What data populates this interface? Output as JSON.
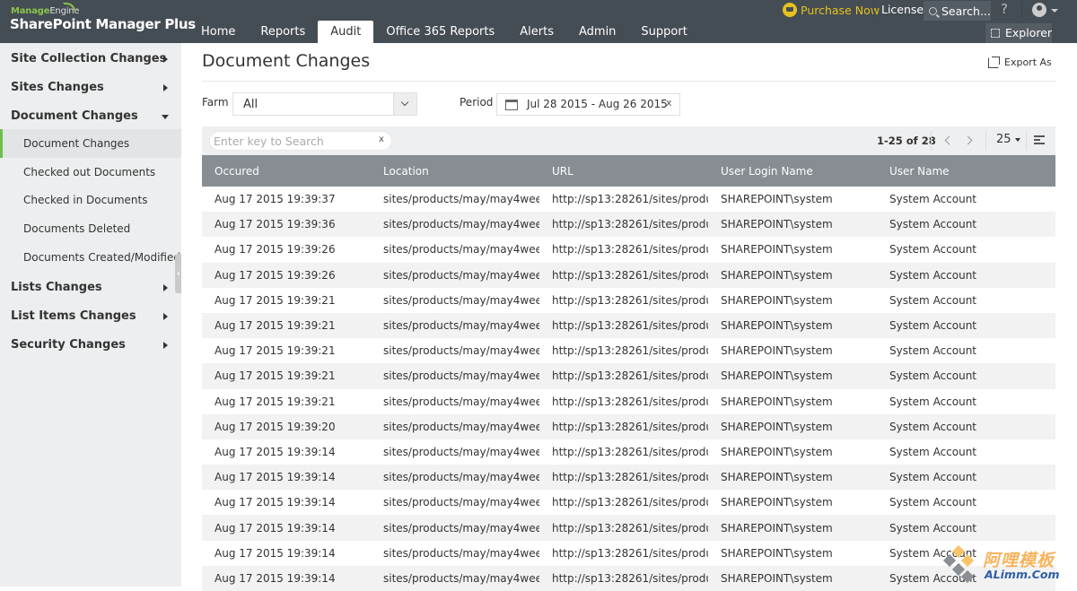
{
  "app": {
    "brand_prefix": "Manage",
    "brand_suffix": "Engine",
    "product_name": "SharePoint Manager Plus"
  },
  "nav": {
    "tabs": [
      {
        "label": "Home",
        "active": false
      },
      {
        "label": "Reports",
        "active": false
      },
      {
        "label": "Audit",
        "active": true
      },
      {
        "label": "Office 365 Reports",
        "active": false
      },
      {
        "label": "Alerts",
        "active": false
      },
      {
        "label": "Admin",
        "active": false
      },
      {
        "label": "Support",
        "active": false
      }
    ]
  },
  "header_actions": {
    "purchase_label": "Purchase Now",
    "license_label": "License",
    "search_label": "Search...",
    "help_label": "?",
    "explorer_label": "Explorer"
  },
  "sidebar": {
    "groups": [
      {
        "label": "Site Collection Changes",
        "expanded": false
      },
      {
        "label": "Sites Changes",
        "expanded": false
      },
      {
        "label": "Document Changes",
        "expanded": true,
        "items": [
          {
            "label": "Document Changes",
            "active": true
          },
          {
            "label": "Checked out Documents",
            "active": false
          },
          {
            "label": "Checked in Documents",
            "active": false
          },
          {
            "label": "Documents Deleted",
            "active": false
          },
          {
            "label": "Documents Created/Modified",
            "active": false
          }
        ]
      },
      {
        "label": "Lists Changes",
        "expanded": false
      },
      {
        "label": "List Items Changes",
        "expanded": false
      },
      {
        "label": "Security Changes",
        "expanded": false
      }
    ]
  },
  "main": {
    "title": "Document Changes",
    "export_label": "Export As",
    "farm_label": "Farm :",
    "farm_value": "All",
    "period_label": "Period :",
    "period_value": "Jul 28 2015 - Aug 26 2015",
    "period_clear": "x",
    "search_placeholder": "Enter key to Search",
    "search_value": "",
    "search_clear": "x",
    "pagination": "1-25 of 28",
    "per_page": "25"
  },
  "table": {
    "columns": [
      "Occured",
      "Location",
      "URL",
      "User Login Name",
      "User Name"
    ],
    "rows": [
      [
        "Aug 17 2015 19:39:37",
        "sites/products/may/may4wee...",
        "http://sp13:28261/sites/produ...",
        "SHAREPOINT\\system",
        "System Account"
      ],
      [
        "Aug 17 2015 19:39:36",
        "sites/products/may/may4wee...",
        "http://sp13:28261/sites/produ...",
        "SHAREPOINT\\system",
        "System Account"
      ],
      [
        "Aug 17 2015 19:39:26",
        "sites/products/may/may4wee...",
        "http://sp13:28261/sites/produ...",
        "SHAREPOINT\\system",
        "System Account"
      ],
      [
        "Aug 17 2015 19:39:26",
        "sites/products/may/may4wee...",
        "http://sp13:28261/sites/produ...",
        "SHAREPOINT\\system",
        "System Account"
      ],
      [
        "Aug 17 2015 19:39:21",
        "sites/products/may/may4wee...",
        "http://sp13:28261/sites/produ...",
        "SHAREPOINT\\system",
        "System Account"
      ],
      [
        "Aug 17 2015 19:39:21",
        "sites/products/may/may4wee...",
        "http://sp13:28261/sites/produ...",
        "SHAREPOINT\\system",
        "System Account"
      ],
      [
        "Aug 17 2015 19:39:21",
        "sites/products/may/may4wee...",
        "http://sp13:28261/sites/produ...",
        "SHAREPOINT\\system",
        "System Account"
      ],
      [
        "Aug 17 2015 19:39:21",
        "sites/products/may/may4wee...",
        "http://sp13:28261/sites/produ...",
        "SHAREPOINT\\system",
        "System Account"
      ],
      [
        "Aug 17 2015 19:39:21",
        "sites/products/may/may4wee...",
        "http://sp13:28261/sites/produ...",
        "SHAREPOINT\\system",
        "System Account"
      ],
      [
        "Aug 17 2015 19:39:20",
        "sites/products/may/may4wee...",
        "http://sp13:28261/sites/produ...",
        "SHAREPOINT\\system",
        "System Account"
      ],
      [
        "Aug 17 2015 19:39:14",
        "sites/products/may/may4wee...",
        "http://sp13:28261/sites/produ...",
        "SHAREPOINT\\system",
        "System Account"
      ],
      [
        "Aug 17 2015 19:39:14",
        "sites/products/may/may4wee...",
        "http://sp13:28261/sites/produ...",
        "SHAREPOINT\\system",
        "System Account"
      ],
      [
        "Aug 17 2015 19:39:14",
        "sites/products/may/may4wee...",
        "http://sp13:28261/sites/produ...",
        "SHAREPOINT\\system",
        "System Account"
      ],
      [
        "Aug 17 2015 19:39:14",
        "sites/products/may/may4wee...",
        "http://sp13:28261/sites/produ...",
        "SHAREPOINT\\system",
        "System Account"
      ],
      [
        "Aug 17 2015 19:39:14",
        "sites/products/may/may4wee...",
        "http://sp13:28261/sites/produ...",
        "SHAREPOINT\\system",
        "System Account"
      ],
      [
        "Aug 17 2015 19:39:14",
        "sites/products/may/may4wee...",
        "http://sp13:28261/sites/produ...",
        "SHAREPOINT\\system",
        "System Account"
      ]
    ]
  },
  "watermark": {
    "cn": "阿哩模板",
    "en": "ALimm.Com"
  },
  "colors": {
    "topbar": "#454d54",
    "accent_green": "#6cc04a",
    "purchase_yellow": "#e6c21f",
    "table_header": "#878d93",
    "sidebar_bg": "#eceeef"
  }
}
